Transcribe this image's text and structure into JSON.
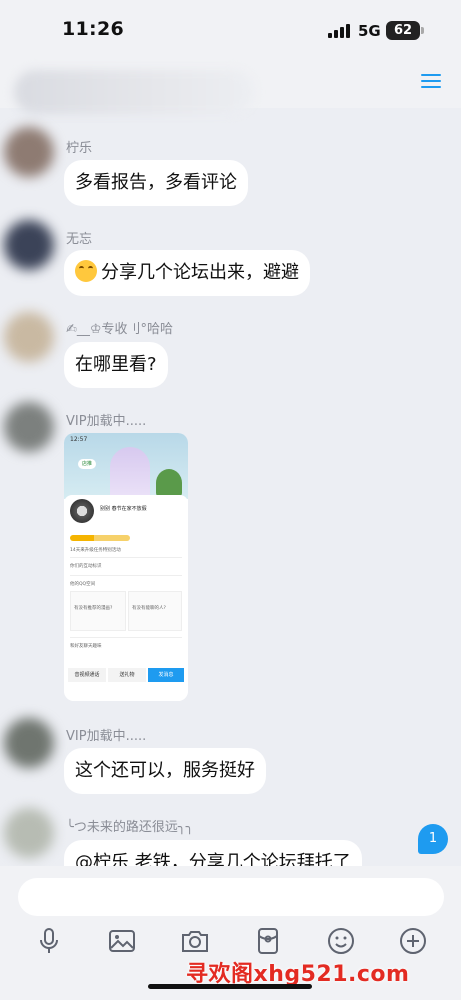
{
  "status_bar": {
    "time": "11:26",
    "network": "5G",
    "battery": "62"
  },
  "header": {
    "menu_icon": "hamburger-menu-icon"
  },
  "messages": [
    {
      "sender": "柠乐",
      "text": "多看报告，多看评论"
    },
    {
      "sender": "无忘",
      "emoji": "laugh-cry-emoji",
      "text": "分享几个论坛出来，避避"
    },
    {
      "sender": "✍︎__♔专收刂°哈哈",
      "text": "在哪里看?"
    },
    {
      "sender": "VIP加载中.....",
      "image": {
        "time": "12:57",
        "tag": "店推",
        "name": "别别  春节在家不放假",
        "row1": "14天来升级任务特别活动",
        "row2": "你们的互动标识",
        "row3": "他的QQ空间",
        "box1": "有没有推荐的漫画?",
        "box2": "有没有能聊的人?",
        "row4": "和好友聊天趣味",
        "btn1": "音视频通话",
        "btn2": "送礼物",
        "btn3": "发消息"
      }
    },
    {
      "sender": "VIP加载中.....",
      "text": "这个还可以，服务挺好"
    },
    {
      "sender": "╰つ未来的路还很远╮╮",
      "text": "@柠乐 老铁，分享几个论坛拜托了"
    }
  ],
  "unread_count": "1",
  "toolbar": {
    "icons": [
      "microphone-icon",
      "image-icon",
      "camera-icon",
      "red-packet-icon",
      "emoji-icon",
      "plus-icon"
    ]
  },
  "watermark": "寻欢阁xhg521.com",
  "colors": {
    "accent": "#1e9bf0",
    "background": "#eceef3",
    "bubble": "#ffffff",
    "watermark": "#e32b22"
  }
}
